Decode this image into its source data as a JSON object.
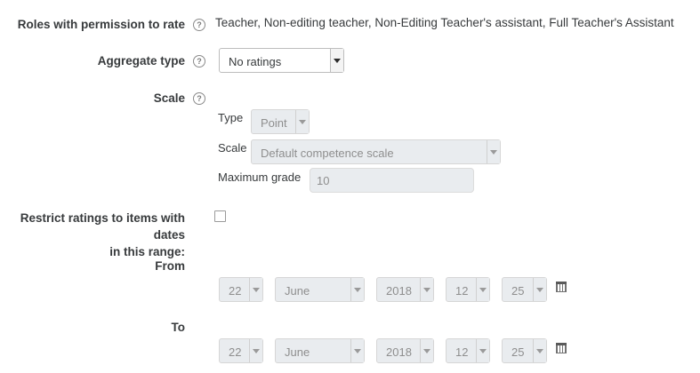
{
  "roles": {
    "label": "Roles with permission to rate",
    "help_icon": "question-circle-icon",
    "value": "Teacher, Non-editing teacher, Non-Editing Teacher's assistant, Full Teacher's Assistant"
  },
  "aggregate": {
    "label": "Aggregate type",
    "help_icon": "question-circle-icon",
    "value": "No ratings"
  },
  "scale": {
    "label": "Scale",
    "help_icon": "question-circle-icon",
    "type_label": "Type",
    "type_value": "Point",
    "scale_label": "Scale",
    "scale_value": "Default competence scale",
    "max_label": "Maximum grade",
    "max_value": "10"
  },
  "restrict": {
    "label_line1": "Restrict ratings to items with dates",
    "label_line2": "in this range:",
    "checked": false
  },
  "from": {
    "label": "From",
    "day": "22",
    "month": "June",
    "year": "2018",
    "hour": "12",
    "minute": "25",
    "calendar_icon": "calendar-icon"
  },
  "to": {
    "label": "To",
    "day": "22",
    "month": "June",
    "year": "2018",
    "hour": "12",
    "minute": "25",
    "calendar_icon": "calendar-icon"
  },
  "colors": {
    "label_text": "#373a3c",
    "disabled_bg": "#e9ecef",
    "disabled_text": "#8e8e8e",
    "border": "#bdbdbd"
  }
}
